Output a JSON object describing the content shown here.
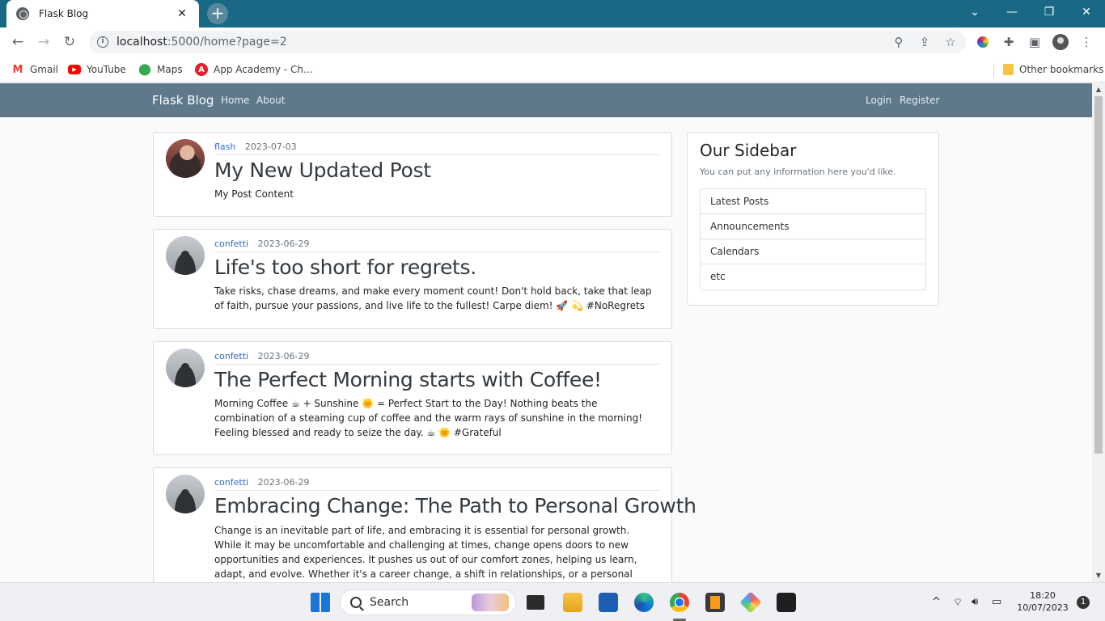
{
  "browser": {
    "tab_title": "Flask Blog",
    "tab_close": "✕",
    "new_tab": "+",
    "url_host": "localhost",
    "url_path": ":5000/home?page=2",
    "bookmarks": [
      {
        "label": "Gmail",
        "icon": "gmail-icon"
      },
      {
        "label": "YouTube",
        "icon": "youtube-icon"
      },
      {
        "label": "Maps",
        "icon": "maps-icon"
      },
      {
        "label": "App Academy - Ch...",
        "icon": "app-academy-icon"
      }
    ],
    "other_bookmarks": "Other bookmarks"
  },
  "navbar": {
    "brand": "Flask Blog",
    "links": [
      "Home",
      "About"
    ],
    "auth": [
      "Login",
      "Register"
    ]
  },
  "posts": [
    {
      "author": "flash",
      "date": "2023-07-03",
      "title": "My New Updated Post",
      "content": "My Post Content",
      "avatar": "flash"
    },
    {
      "author": "confetti",
      "date": "2023-06-29",
      "title": "Life's too short for regrets.",
      "content": "Take risks, chase dreams, and make every moment count! Don't hold back, take that leap of faith, pursue your passions, and live life to the fullest! Carpe diem! 🚀 💫 #NoRegrets",
      "avatar": "confetti"
    },
    {
      "author": "confetti",
      "date": "2023-06-29",
      "title": "The Perfect Morning starts with Coffee!",
      "content": "Morning Coffee ☕ + Sunshine 🌞 = Perfect Start to the Day! Nothing beats the combination of a steaming cup of coffee and the warm rays of sunshine in the morning! Feeling blessed and ready to seize the day. ☕ 🌞 #Grateful",
      "avatar": "confetti"
    },
    {
      "author": "confetti",
      "date": "2023-06-29",
      "title": "Embracing Change: The Path to Personal Growth",
      "content": "Change is an inevitable part of life, and embracing it is essential for personal growth. While it may be uncomfortable and challenging at times, change opens doors to new opportunities and experiences. It pushes us out of our comfort zones, helping us learn, adapt, and evolve. Whether it's a career change, a shift in relationships, or a personal transformation, embracing change allows us to discover our true",
      "avatar": "confetti"
    }
  ],
  "sidebar": {
    "title": "Our Sidebar",
    "subtitle": "You can put any information here you'd like.",
    "items": [
      "Latest Posts",
      "Announcements",
      "Calendars",
      "etc"
    ]
  },
  "taskbar": {
    "search": "Search",
    "time": "18:20",
    "date": "10/07/2023",
    "notifications": "1"
  }
}
